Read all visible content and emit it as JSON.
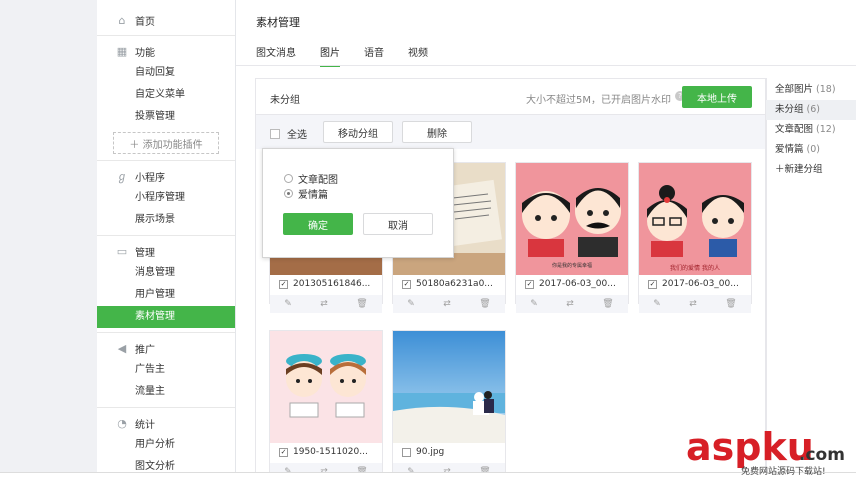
{
  "sidebar": {
    "home": "首页",
    "function": {
      "title": "功能",
      "items": [
        "自动回复",
        "自定义菜单",
        "投票管理"
      ],
      "plugin": "＋ 添加功能插件"
    },
    "miniprogram": {
      "title": "小程序",
      "items": [
        "小程序管理",
        "展示场景"
      ]
    },
    "manage": {
      "title": "管理",
      "items": [
        "消息管理",
        "用户管理",
        "素材管理"
      ]
    },
    "promote": {
      "title": "推广",
      "items": [
        "广告主",
        "流量主"
      ]
    },
    "stats": {
      "title": "统计",
      "items": [
        "用户分析",
        "图文分析"
      ]
    }
  },
  "main": {
    "title": "素材管理",
    "tabs": [
      "图文消息",
      "图片",
      "语音",
      "视频"
    ],
    "group_name": "未分组",
    "hint": "大小不超过5M，已开启图片水印",
    "upload": "本地上传",
    "select_all": "全选",
    "move_group": "移动分组",
    "delete": "删除",
    "images": [
      {
        "name": "201305161846...",
        "checked": true
      },
      {
        "name": "50180a6231a0...",
        "checked": true
      },
      {
        "name": "2017-06-03_00...",
        "checked": true
      },
      {
        "name": "2017-06-03_00...",
        "checked": true
      },
      {
        "name": "1950-1511020...",
        "checked": true
      },
      {
        "name": "90.jpg",
        "checked": false
      }
    ],
    "pic_texts": {
      "wedding": "你是我的专属幸福",
      "lovers": "我们的爱情 我的人"
    }
  },
  "popup": {
    "options": [
      "文章配图",
      "爱情篇"
    ],
    "selected": 1,
    "ok": "确定",
    "cancel": "取消"
  },
  "groups": [
    {
      "name": "全部图片",
      "count": "(18)"
    },
    {
      "name": "未分组",
      "count": "(6)"
    },
    {
      "name": "文章配图",
      "count": "(12)"
    },
    {
      "name": "爱情篇",
      "count": "(0)"
    }
  ],
  "new_group": "＋新建分组",
  "watermark": {
    "brand": "aspku",
    "tld": ".com",
    "tagline": "免费网站源码下载站!"
  },
  "colors": {
    "accent": "#44b549"
  }
}
